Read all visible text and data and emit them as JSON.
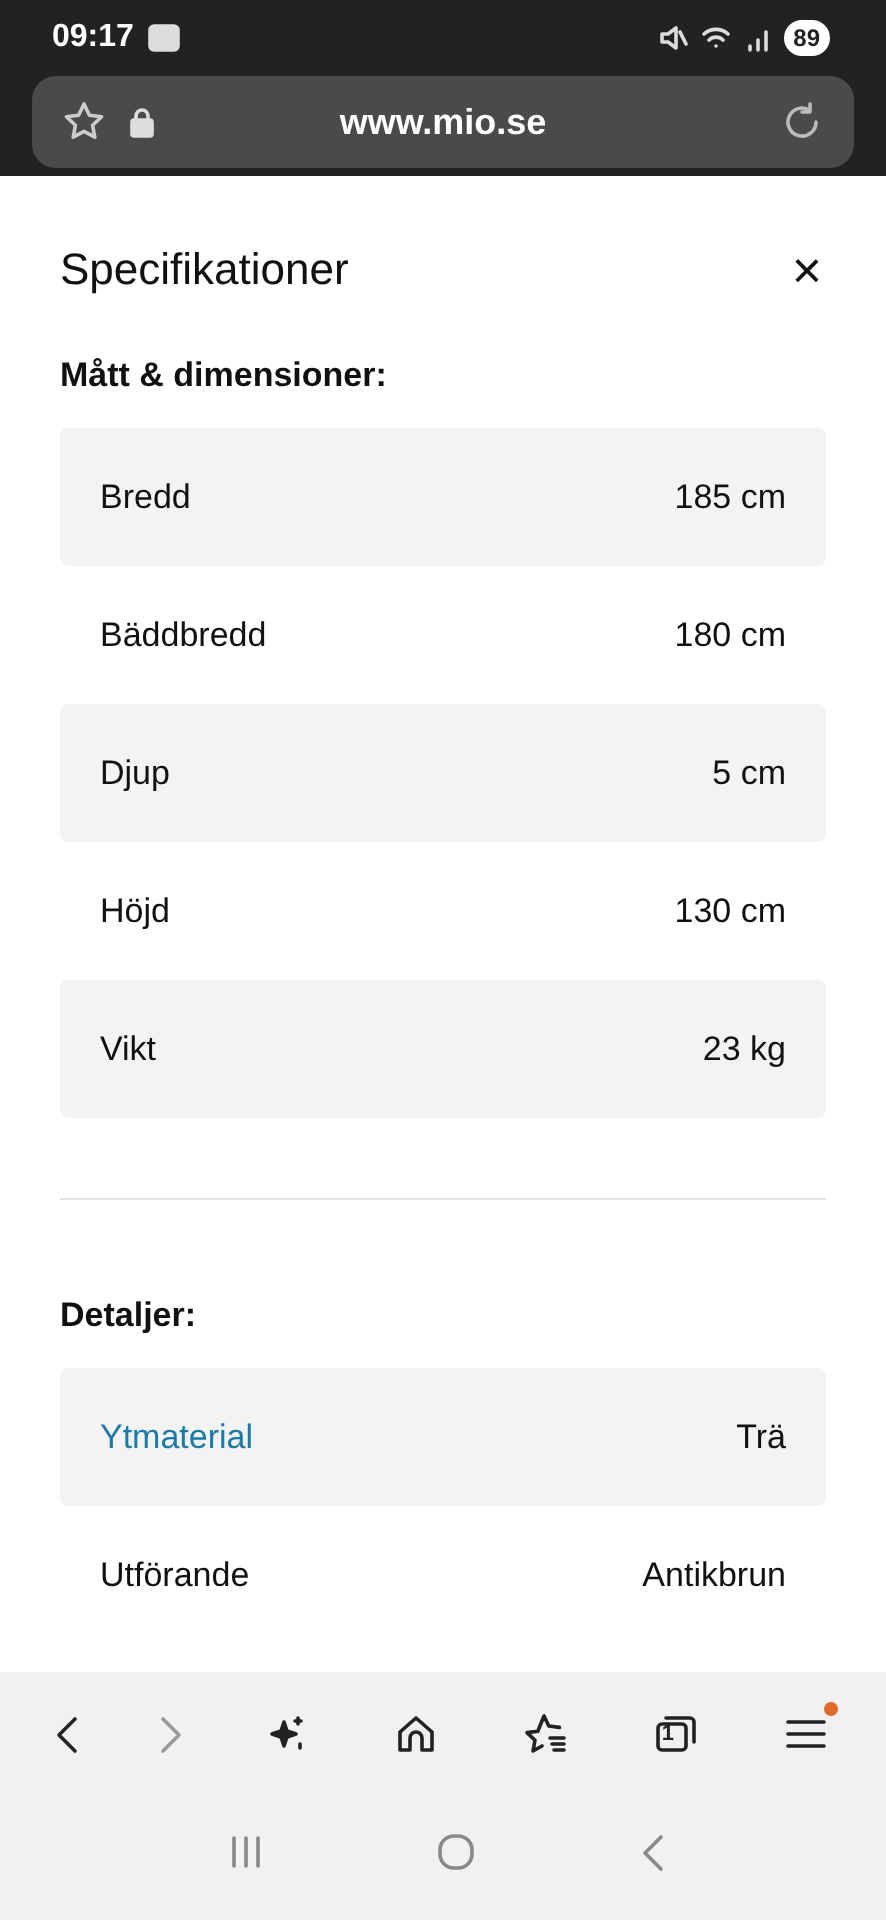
{
  "status_bar": {
    "time": "09:17",
    "battery": "89"
  },
  "address_bar": {
    "url": "www.mio.se"
  },
  "panel": {
    "title": "Specifikationer",
    "close": "×"
  },
  "sections": [
    {
      "heading": "Mått & dimensioner:",
      "rows": [
        {
          "label": "Bredd",
          "value": "185 cm",
          "shaded": true,
          "kind": "plain"
        },
        {
          "label": "Bäddbredd",
          "value": "180 cm",
          "shaded": false,
          "kind": "plain"
        },
        {
          "label": "Djup",
          "value": "5 cm",
          "shaded": true,
          "kind": "plain"
        },
        {
          "label": "Höjd",
          "value": "130 cm",
          "shaded": false,
          "kind": "plain"
        },
        {
          "label": "Vikt",
          "value": "23 kg",
          "shaded": true,
          "kind": "plain"
        }
      ]
    },
    {
      "heading": "Detaljer:",
      "rows": [
        {
          "label": "Ytmaterial",
          "value": "Trä",
          "shaded": true,
          "kind": "link"
        },
        {
          "label": "Utförande",
          "value": "Antikbrun",
          "shaded": false,
          "kind": "plain"
        }
      ]
    }
  ],
  "toolbar": {
    "tab_count": "1",
    "menu_notification": true
  }
}
